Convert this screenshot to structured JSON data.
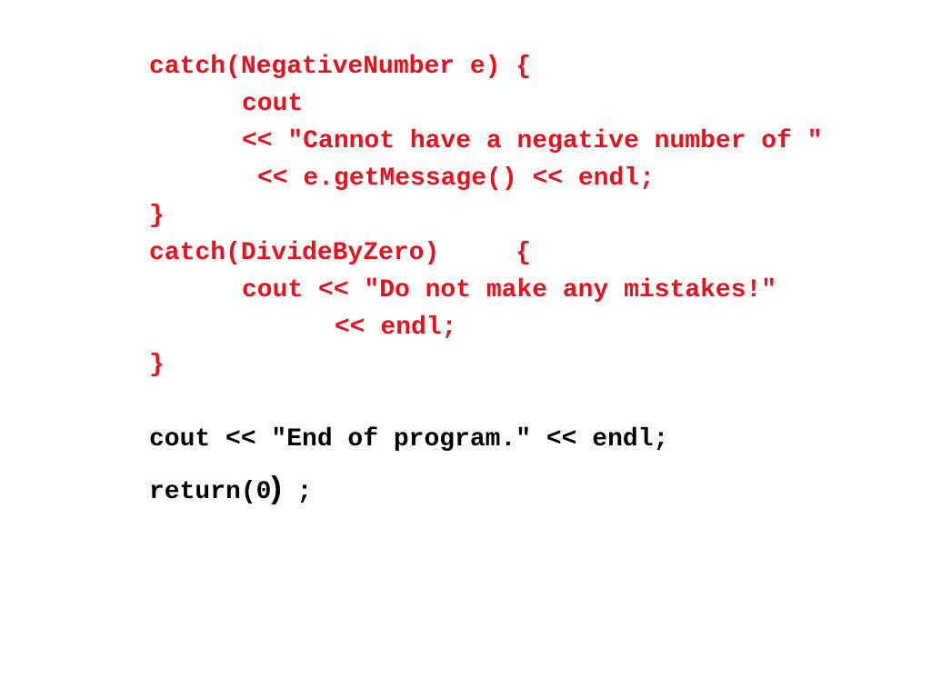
{
  "slide": {
    "red_lines": [
      "catch(NegativeNumber e) {",
      "cout",
      "<< \"Cannot have a negative number of \"",
      "<< e.getMessage() << endl;",
      "}",
      "catch(DivideByZero)     {",
      "cout << \"Do not make any mistakes!\"",
      "<< endl;",
      "}"
    ],
    "black_lines": [
      "cout << \"End of program.\" << endl;",
      "return(0"
    ],
    "return_close": ")",
    "return_semicolon": " ;"
  },
  "colors": {
    "code_red": "#e8101b",
    "code_black": "#000000"
  }
}
